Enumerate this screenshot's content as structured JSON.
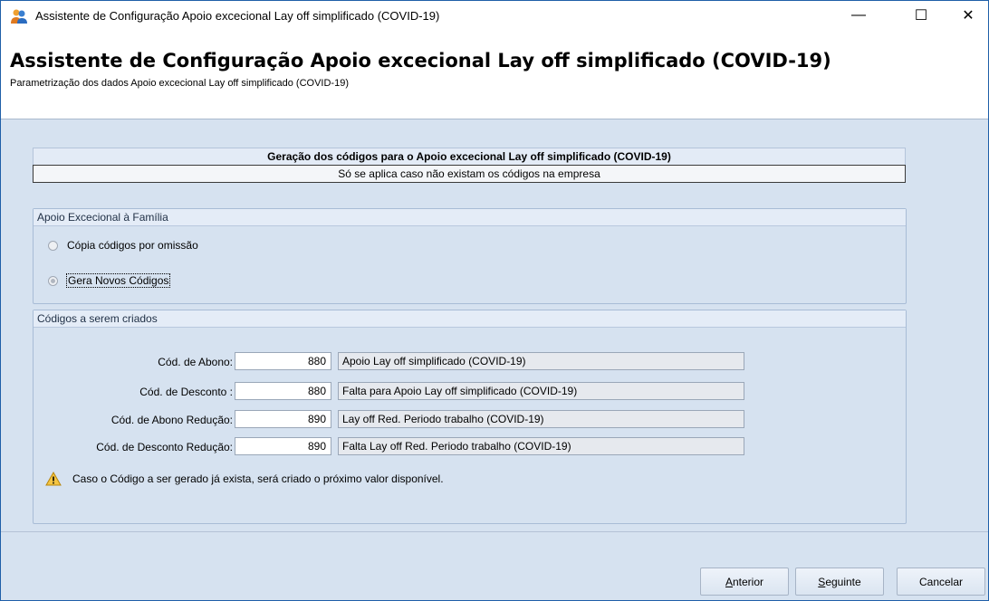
{
  "window": {
    "title": "Assistente de Configuração Apoio excecional Lay off simplificado (COVID-19)",
    "minimize": "—",
    "maximize": "☐",
    "close": "✕"
  },
  "header": {
    "title": "Assistente de Configuração Apoio excecional Lay off simplificado (COVID-19)",
    "subtitle": "Parametrização dos dados Apoio excecional Lay off simplificado (COVID-19)"
  },
  "generation": {
    "title": "Geração dos códigos para o Apoio excecional Lay off simplificado (COVID-19)",
    "note": "Só se aplica caso não existam os códigos na empresa"
  },
  "family_group": {
    "heading": "Apoio Excecional à Família",
    "options": [
      {
        "label": "Cópia códigos por omissão",
        "selected": false
      },
      {
        "label": "Gera Novos Códigos",
        "selected": true
      }
    ]
  },
  "codes_group": {
    "heading": "Códigos a serem criados",
    "rows": [
      {
        "label": "Cód. de Abono:",
        "value": "880",
        "description": "Apoio Lay off simplificado (COVID-19)"
      },
      {
        "label": "Cód. de Desconto :",
        "value": "880",
        "description": "Falta para Apoio Lay off simplificado (COVID-19)"
      },
      {
        "label": "Cód. de Abono Redução:",
        "value": "890",
        "description": "Lay off Red. Periodo trabalho (COVID-19)"
      },
      {
        "label": "Cód. de Desconto Redução:",
        "value": "890",
        "description": "Falta Lay off Red. Periodo trabalho (COVID-19)"
      }
    ],
    "warning": "Caso o Código a ser gerado já exista, será criado o próximo valor disponível.",
    "warning_icon": "warning-triangle-icon"
  },
  "footer": {
    "anterior_u": "A",
    "anterior_rest": "nterior",
    "seguinte_u": "S",
    "seguinte_rest": "eguinte",
    "cancelar": "Cancelar"
  },
  "colors": {
    "panel": "#d6e2f0",
    "title_blue": "#1f5fa8"
  }
}
